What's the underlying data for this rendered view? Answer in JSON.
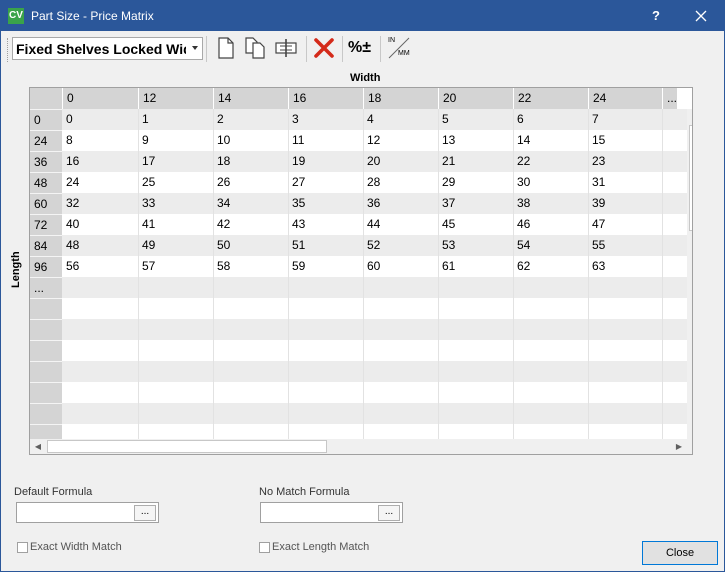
{
  "window": {
    "app_badge": "CV",
    "title": "Part Size - Price Matrix",
    "help_label": "?"
  },
  "toolbar": {
    "matrix_name": "Fixed Shelves Locked Wid",
    "icons": [
      "new-page-icon",
      "copy-pages-icon",
      "column-edit-icon",
      "delete-x-icon",
      "percent-plus-minus-icon",
      "inch-mm-toggle-icon"
    ],
    "percent_label": "%±",
    "unit_top": "IN",
    "unit_bottom": "MM"
  },
  "grid": {
    "width_label": "Width",
    "length_label": "Length",
    "column_headers": [
      "0",
      "12",
      "14",
      "16",
      "18",
      "20",
      "22",
      "24",
      "..."
    ],
    "rows": [
      {
        "length": "0",
        "values": [
          "0",
          "1",
          "2",
          "3",
          "4",
          "5",
          "6",
          "7"
        ]
      },
      {
        "length": "24",
        "values": [
          "8",
          "9",
          "10",
          "11",
          "12",
          "13",
          "14",
          "15"
        ]
      },
      {
        "length": "36",
        "values": [
          "16",
          "17",
          "18",
          "19",
          "20",
          "21",
          "22",
          "23"
        ]
      },
      {
        "length": "48",
        "values": [
          "24",
          "25",
          "26",
          "27",
          "28",
          "29",
          "30",
          "31"
        ]
      },
      {
        "length": "60",
        "values": [
          "32",
          "33",
          "34",
          "35",
          "36",
          "37",
          "38",
          "39"
        ]
      },
      {
        "length": "72",
        "values": [
          "40",
          "41",
          "42",
          "43",
          "44",
          "45",
          "46",
          "47"
        ]
      },
      {
        "length": "84",
        "values": [
          "48",
          "49",
          "50",
          "51",
          "52",
          "53",
          "54",
          "55"
        ]
      },
      {
        "length": "96",
        "values": [
          "56",
          "57",
          "58",
          "59",
          "60",
          "61",
          "62",
          "63"
        ]
      },
      {
        "length": "...",
        "values": [
          "",
          "",
          "",
          "",
          "",
          "",
          "",
          ""
        ]
      }
    ],
    "blank_row_count": 7
  },
  "form": {
    "default_formula_label": "Default Formula",
    "default_formula_value": "",
    "no_match_formula_label": "No Match Formula",
    "no_match_formula_value": "",
    "ellipsis_label": "...",
    "exact_width_label": "Exact Width Match",
    "exact_width_checked": false,
    "exact_length_label": "Exact Length Match",
    "exact_length_checked": false,
    "close_label": "Close"
  }
}
